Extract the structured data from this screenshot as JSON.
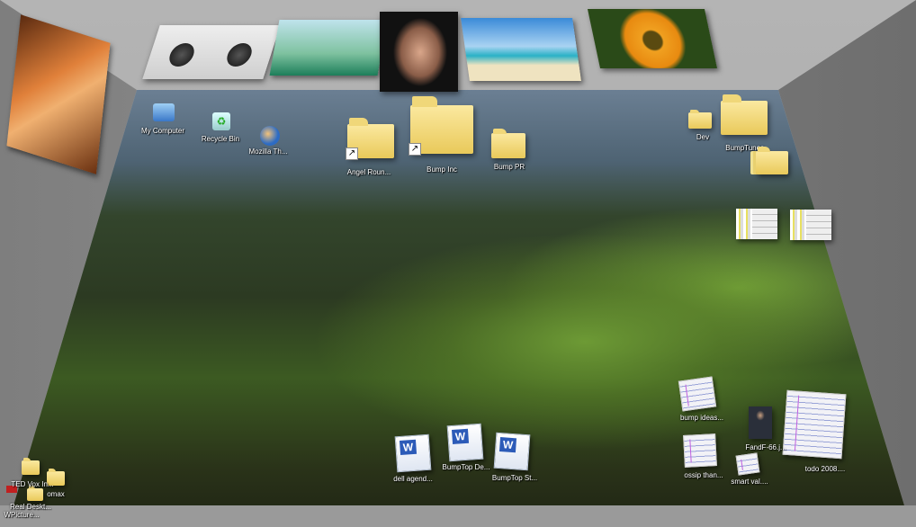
{
  "desktop": {
    "top_left_icons": [
      {
        "label": "My Computer",
        "icon": "computer-icon"
      },
      {
        "label": "Recycle Bin",
        "icon": "recycle-bin-icon"
      },
      {
        "label": "Mozilla Th...",
        "icon": "thunderbird-icon"
      }
    ],
    "top_folders": [
      {
        "label": "Angel Roun...",
        "shortcut": true
      },
      {
        "label": "Bump Inc",
        "shortcut": true
      },
      {
        "label": "Bump PR",
        "shortcut": false
      }
    ],
    "right_folders": [
      {
        "label": "Dev"
      },
      {
        "label": "BumpTunes..."
      }
    ],
    "word_docs": [
      {
        "label": "dell agend..."
      },
      {
        "label": "BumpTop De..."
      },
      {
        "label": "BumpTop St..."
      }
    ],
    "text_docs": [
      {
        "label": "bump ideas..."
      },
      {
        "label": "ossip than..."
      },
      {
        "label": "smart val...."
      },
      {
        "label": "todo 2008...."
      }
    ],
    "photo": {
      "label": "FandF-66.j..."
    },
    "left_wall_items": [
      {
        "label": "TED Vox In..."
      },
      {
        "label": "omax"
      },
      {
        "label": "Real Deskt..."
      },
      {
        "label": "WPicture..."
      }
    ],
    "wall_pictures": [
      "boombox-picture",
      "clouds-picture",
      "portrait-picture",
      "beach-picture",
      "sunflower-picture",
      "canyon-picture"
    ]
  }
}
